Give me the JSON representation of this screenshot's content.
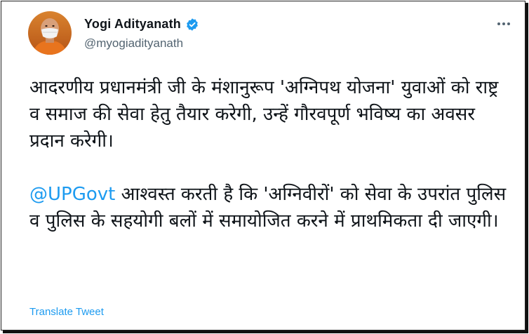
{
  "author": {
    "display_name": "Yogi Adityanath",
    "handle": "@myogiadityanath",
    "verified": true
  },
  "tweet": {
    "paragraph_1": "आदरणीय प्रधानमंत्री जी के मंशानुरूप 'अग्निपथ योजना' युवाओं को राष्ट्र व समाज की सेवा हेतु तैयार करेगी, उन्हें गौरवपूर्ण भविष्य का अवसर प्रदान करेगी।",
    "mention": "@UPGovt",
    "paragraph_2_rest": " आश्वस्त करती है कि 'अग्निवीरों' को सेवा के उपरांत पुलिस व पुलिस के सहयोगी बलों में समायोजित करने में प्राथमिकता दी जाएगी।"
  },
  "translate_label": "Translate Tweet",
  "icons": {
    "more": "more-options-icon",
    "verified": "verified-badge-icon"
  },
  "colors": {
    "link": "#1d9bf0",
    "text": "#0f1419",
    "secondary": "#536471"
  }
}
